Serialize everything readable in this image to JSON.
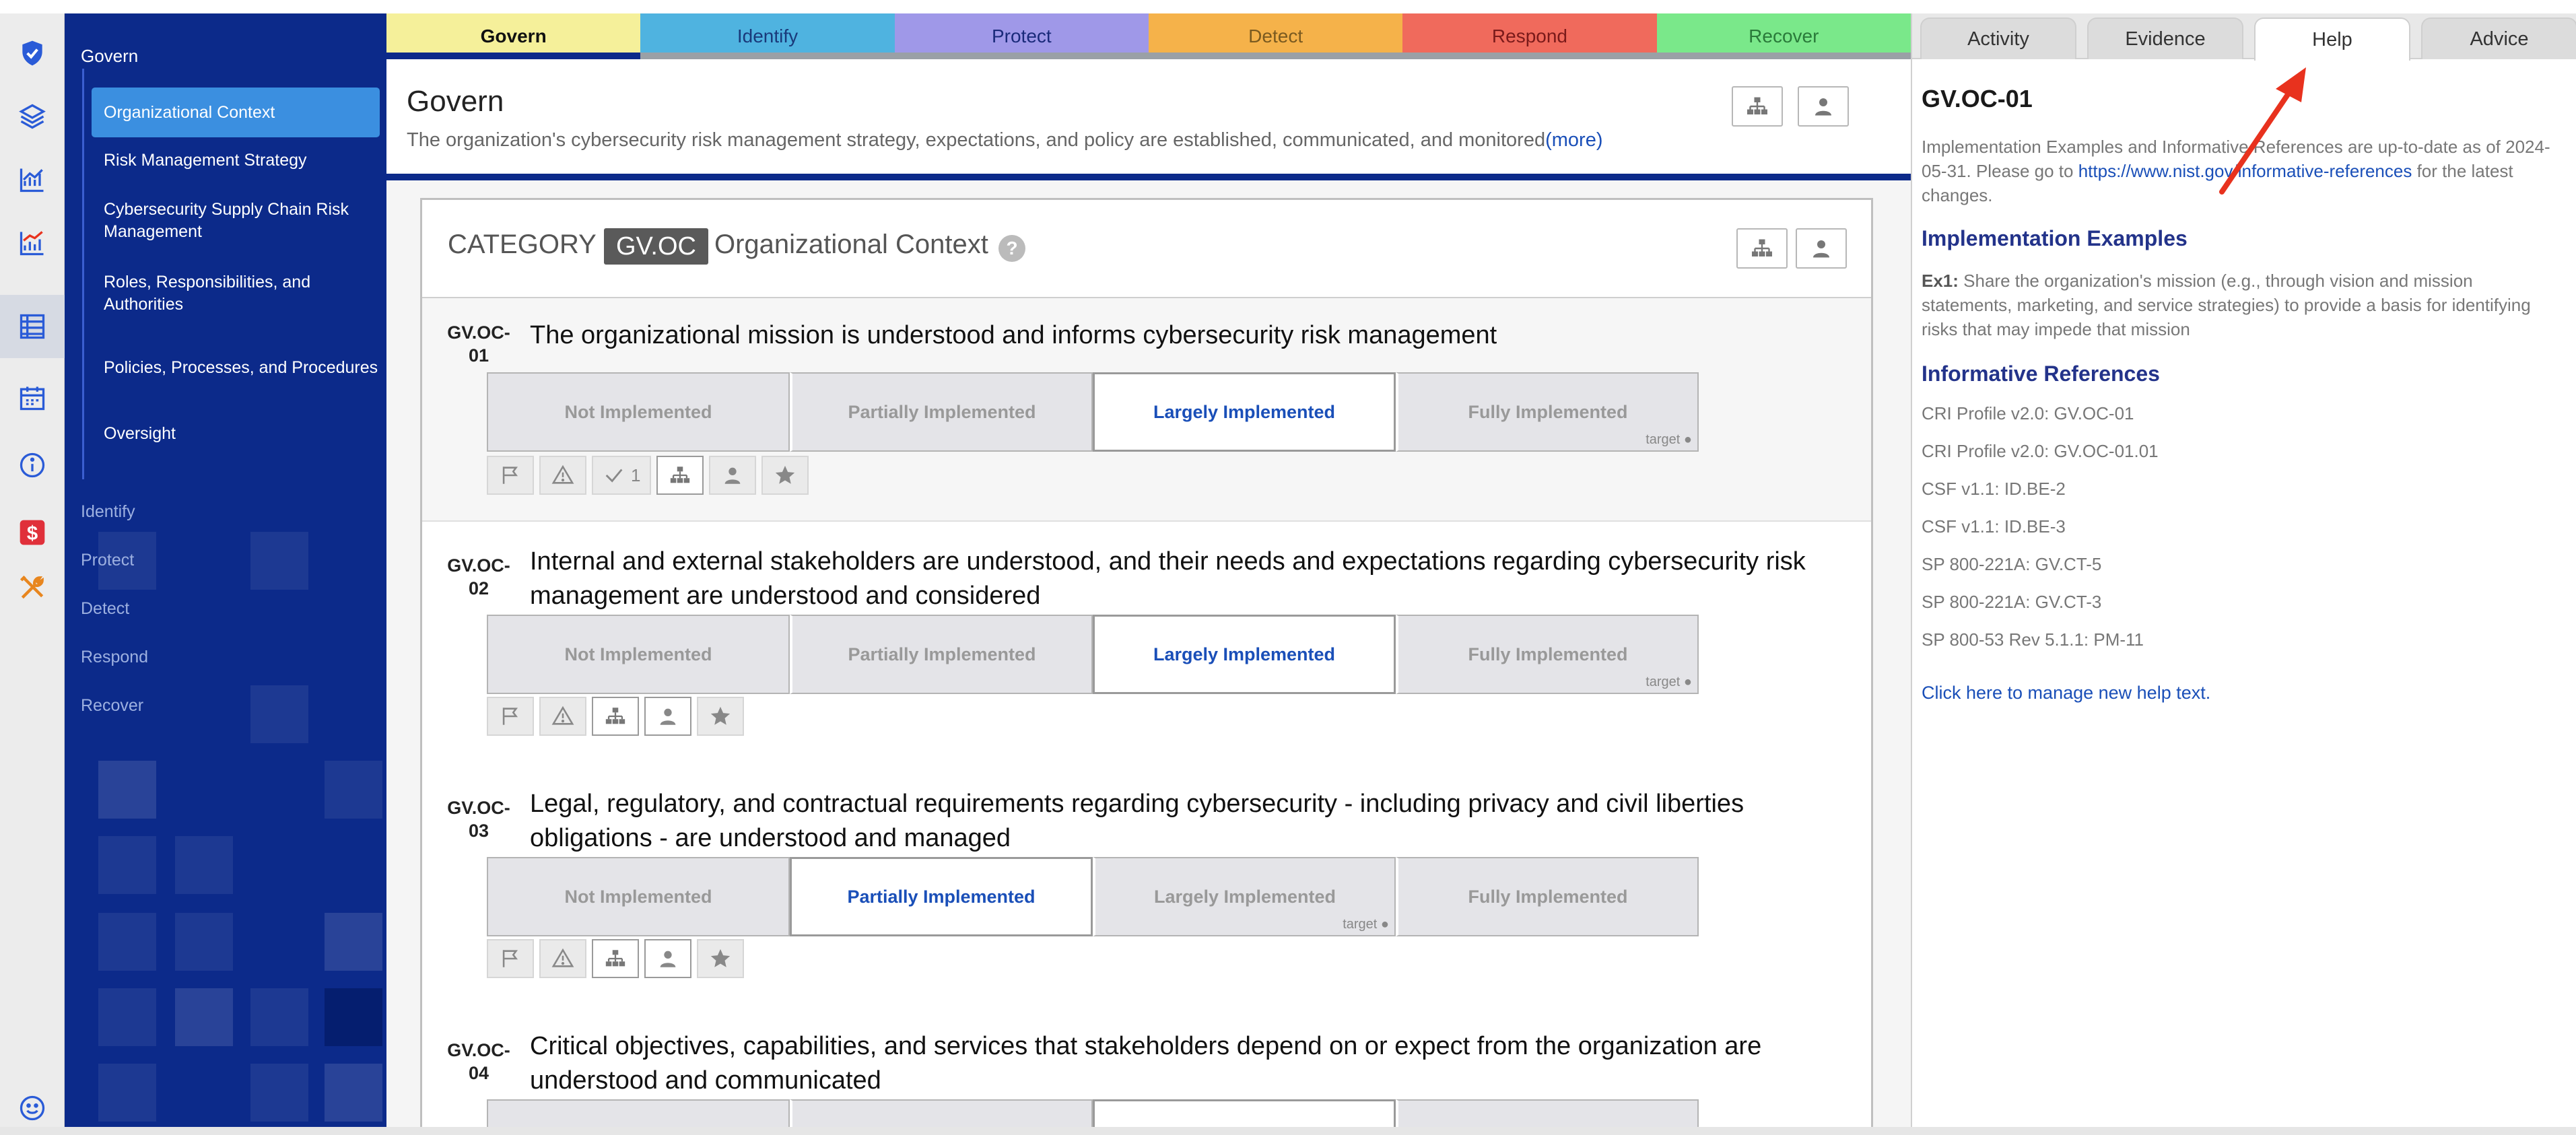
{
  "colors": {
    "navy": "#0c2a8a",
    "active_nav": "#3b8fe0",
    "link": "#1a4fb8",
    "govern": "#f5f09a",
    "identify": "#4fb3e0",
    "protect": "#9f98e8",
    "detect": "#f5b24a",
    "respond": "#f06a5c",
    "recover": "#7ae88a",
    "annotation_arrow": "#e8321e"
  },
  "rail_icons": [
    "shield-check-icon",
    "layers-icon",
    "chart-line-icon",
    "chart-bar-up-icon",
    "table-list-icon",
    "calendar-icon",
    "info-icon",
    "dollar-icon",
    "tools-icon",
    "smiley-icon"
  ],
  "sidebar": {
    "group": "Govern",
    "items": [
      {
        "label": "Organizational Context"
      },
      {
        "label": "Risk Management Strategy"
      },
      {
        "label": "Cybersecurity Supply Chain Risk Management"
      },
      {
        "label": "Roles, Responsibilities, and Authorities"
      },
      {
        "label": "Policies, Processes, and Procedures"
      },
      {
        "label": "Oversight"
      }
    ],
    "functions": [
      "Identify",
      "Protect",
      "Detect",
      "Respond",
      "Recover"
    ]
  },
  "function_tabs": [
    {
      "label": "Govern",
      "color": "#f5f09a",
      "text_color": "#111111"
    },
    {
      "label": "Identify",
      "color": "#4fb3e0",
      "text_color": "#1a3a7a"
    },
    {
      "label": "Protect",
      "color": "#9f98e8",
      "text_color": "#1a2a7a"
    },
    {
      "label": "Detect",
      "color": "#f5b24a",
      "text_color": "#7a5a20"
    },
    {
      "label": "Respond",
      "color": "#f06a5c",
      "text_color": "#7a1a1a"
    },
    {
      "label": "Recover",
      "color": "#7ae88a",
      "text_color": "#2a7a3a"
    }
  ],
  "header": {
    "title": "Govern",
    "description": "The organization's cybersecurity risk management strategy, expectations, and policy are established, communicated, and monitored",
    "more_link": "(more)"
  },
  "category": {
    "label": "CATEGORY",
    "code": "GV.OC",
    "name": "Organizational Context",
    "help_icon": "?"
  },
  "levels": [
    "Not Implemented",
    "Partially Implemented",
    "Largely Implemented",
    "Fully Implemented"
  ],
  "target_label": "target ●",
  "subcategories": [
    {
      "id_line1": "GV.OC-",
      "id_line2": "01",
      "text": "The organizational mission is understood and informs cybersecurity risk management",
      "selected": 2,
      "target": 3,
      "check_count": "1"
    },
    {
      "id_line1": "GV.OC-",
      "id_line2": "02",
      "text": "Internal and external stakeholders are understood, and their needs and expectations regarding cybersecurity risk management are understood and considered",
      "selected": 2,
      "target": 3
    },
    {
      "id_line1": "GV.OC-",
      "id_line2": "03",
      "text": "Legal, regulatory, and contractual requirements regarding cybersecurity - including privacy and civil liberties obligations - are understood and managed",
      "selected": 1,
      "target": 2
    },
    {
      "id_line1": "GV.OC-",
      "id_line2": "04",
      "text": "Critical objectives, capabilities, and services that stakeholders depend on or expect from the organization are understood and communicated",
      "selected": 2
    }
  ],
  "right_tabs": [
    {
      "label": "Activity"
    },
    {
      "label": "Evidence"
    },
    {
      "label": "Help"
    },
    {
      "label": "Advice"
    }
  ],
  "help": {
    "title": "GV.OC-01",
    "note_before": "Implementation Examples and Informative References are up-to-date as of 2024-05-31. Please go to ",
    "note_link": "https://www.nist.gov/informative-references",
    "note_after": " for the latest changes.",
    "examples_heading": "Implementation Examples",
    "ex_label": "Ex1:",
    "ex_text": " Share the organization's mission (e.g., through vision and mission statements, marketing, and service strategies) to provide a basis for identifying risks that may impede that mission",
    "refs_heading": "Informative References",
    "references": [
      "CRI Profile v2.0: GV.OC-01",
      "CRI Profile v2.0: GV.OC-01.01",
      "CSF v1.1: ID.BE-2",
      "CSF v1.1: ID.BE-3",
      "SP 800-221A: GV.CT-5",
      "SP 800-221A: GV.CT-3",
      "SP 800-53 Rev 5.1.1: PM-11"
    ],
    "manage_link": "Click here to manage new help text."
  }
}
